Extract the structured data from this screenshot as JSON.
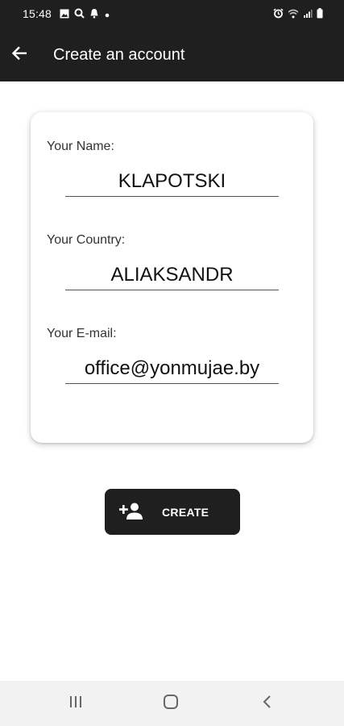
{
  "status_bar": {
    "time": "15:48",
    "left_icons": [
      "image-icon",
      "search-icon",
      "notification-icon",
      "dot-icon"
    ],
    "right_icons": [
      "alarm-icon",
      "wifi-icon",
      "signal-icon",
      "battery-icon"
    ]
  },
  "app_bar": {
    "title": "Create an account",
    "back_icon": "arrow-back-icon",
    "background": "#1f1f1f"
  },
  "form": {
    "name": {
      "label": "Your Name:",
      "value": "KLAPOTSKI"
    },
    "country": {
      "label": "Your Country:",
      "value": "ALIAKSANDR"
    },
    "email": {
      "label": "Your E-mail:",
      "value": "office@yonmujae.by"
    }
  },
  "create_button": {
    "label": "CREATE",
    "icon": "person-add-icon",
    "background": "#1f1f1f"
  },
  "nav_bar": {
    "items": [
      "recent-apps-icon",
      "home-icon",
      "back-icon"
    ]
  }
}
